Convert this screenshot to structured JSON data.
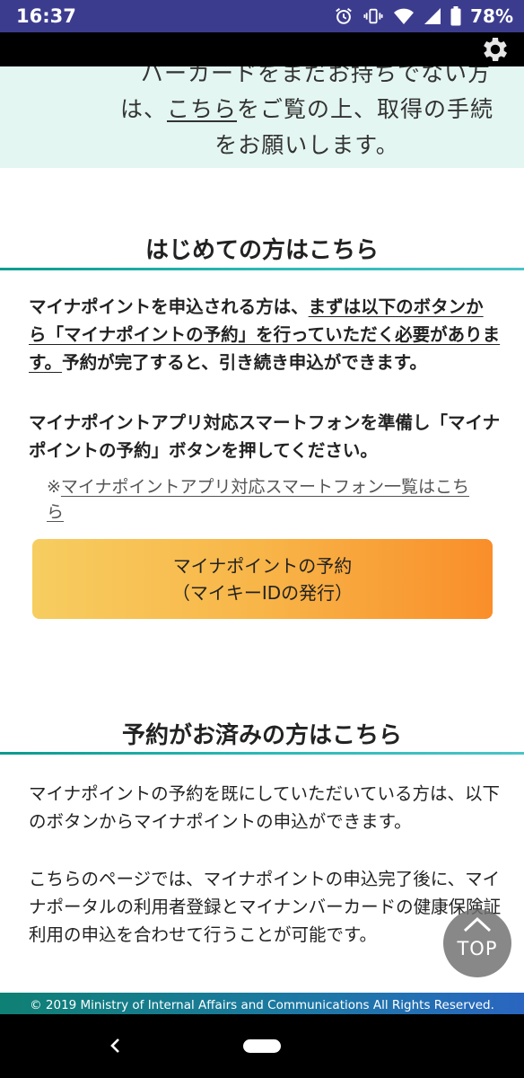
{
  "status_bar": {
    "time": "16:37",
    "battery_percent": "78%",
    "icons": [
      "alarm-icon",
      "vibrate-icon",
      "wifi-icon",
      "signal-icon",
      "battery-icon"
    ]
  },
  "app_bar": {
    "settings_icon": "gear-icon"
  },
  "info_box": {
    "line1": "バーカードをまだお持ちでない方",
    "line2_prefix": "は、",
    "line2_link": "こちら",
    "line2_suffix": "をご覧の上、取得の手続",
    "line3": "をお願いします。"
  },
  "section_first": {
    "heading": "はじめての方はこちら",
    "para1_lead": "マイナポイントを申込される方は、",
    "para1_underlined": "まずは以下のボタンから「マイナポイントの予約」を行っていただく必要があります。",
    "para1_tail": "予約が完了すると、引き続き申込ができます。",
    "para2": "マイナポイントアプリ対応スマートフォンを準備し「マイナポイントの予約」ボタンを押してください。",
    "note_mark": "※",
    "note_link": "マイナポイントアプリ対応スマートフォン一覧はこちら",
    "button_line1": "マイナポイントの予約",
    "button_line2": "（マイキーIDの発行）"
  },
  "section_second": {
    "heading": "予約がお済みの方はこちら",
    "para1": "マイナポイントの予約を既にしていただいている方は、以下のボタンからマイナポイントの申込ができます。",
    "para2": "こちらのページでは、マイナポイントの申込完了後に、マイナポータルの利用者登録とマイナンバーカードの健康保険証利用の申込を合わせて行うことが可能です。"
  },
  "top_button": {
    "label": "TOP"
  },
  "footer": {
    "copyright": "© 2019 Ministry of Internal Affairs and Communications All Rights Reserved."
  },
  "colors": {
    "status_bar": "#3c3c8f",
    "info_box_bg": "#e3f6f1",
    "divider": "#2cb9b6",
    "button_start": "#f7cd60",
    "button_end": "#f98e2a",
    "footer": "#1d78a6"
  }
}
